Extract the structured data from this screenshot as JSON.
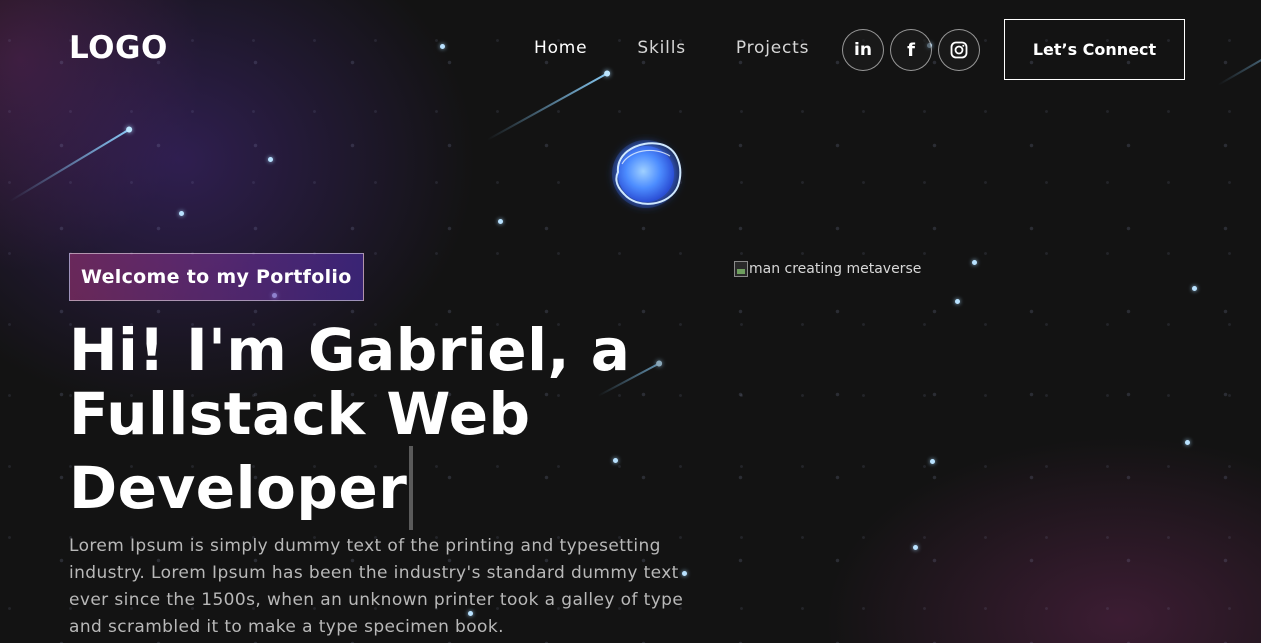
{
  "header": {
    "logo": "LOGO",
    "nav": [
      {
        "label": "Home"
      },
      {
        "label": "Skills"
      },
      {
        "label": "Projects"
      }
    ],
    "social": [
      {
        "icon": "linkedin-icon",
        "glyph": "in"
      },
      {
        "icon": "facebook-icon",
        "glyph": "f"
      },
      {
        "icon": "instagram-icon",
        "glyph": ""
      }
    ],
    "cta_label": "Let’s Connect"
  },
  "hero": {
    "tagline": "Welcome to my Portfolio",
    "headline": "Hi! I'm Gabriel, a Fullstack Web Developer",
    "description": "Lorem Ipsum is simply dummy text of the printing and typesetting industry. Lorem Ipsum has been the industry's standard dummy text ever since the 1500s, when an unknown printer took a galley of type and scrambled it to make a type specimen book.",
    "image_alt": "man creating metaverse"
  },
  "colors": {
    "background": "#121212",
    "tagline_gradient_start": "#AA367C",
    "tagline_gradient_end": "#4A2FBD",
    "star": "#B9E2FF"
  }
}
